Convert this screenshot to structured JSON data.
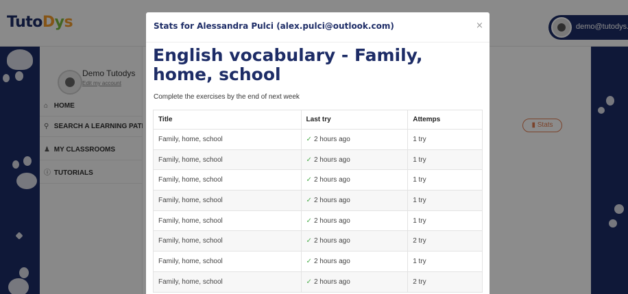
{
  "app": {
    "logo": {
      "part1": "Tuto",
      "part2": "D",
      "part3": "y",
      "part4": "s"
    },
    "user_email": "demo@tutodys.eu",
    "profile": {
      "name": "Demo Tutodys",
      "edit_link": "Edit my account"
    },
    "nav": [
      {
        "label": "HOME",
        "icon": "home-icon"
      },
      {
        "label": "SEARCH A LEARNING PATH",
        "icon": "search-icon"
      },
      {
        "label": "MY CLASSROOMS",
        "icon": "classrooms-icon"
      },
      {
        "label": "TUTORIALS",
        "icon": "tutorials-icon"
      }
    ],
    "stats_button_label": "Stats"
  },
  "modal": {
    "title": "Stats for Alessandra Pulci (alex.pulci@outlook.com)",
    "close_label": "×",
    "lesson_title": "English vocabulary - Family, home, school",
    "lesson_subtitle": "Complete the exercises by the end of next week",
    "table": {
      "headers": [
        "Title",
        "Last try",
        "Attemps"
      ],
      "rows": [
        [
          "Family, home, school",
          "2 hours ago",
          "1 try"
        ],
        [
          "Family, home, school",
          "2 hours ago",
          "1 try"
        ],
        [
          "Family, home, school",
          "2 hours ago",
          "1 try"
        ],
        [
          "Family, home, school",
          "2 hours ago",
          "1 try"
        ],
        [
          "Family, home, school",
          "2 hours ago",
          "1 try"
        ],
        [
          "Family, home, school",
          "2 hours ago",
          "2 try"
        ],
        [
          "Family, home, school",
          "2 hours ago",
          "1 try"
        ],
        [
          "Family, home, school",
          "2 hours ago",
          "2 try"
        ]
      ]
    }
  },
  "colors": {
    "brand_navy": "#1d2c66",
    "accent_orange": "#e07b4f",
    "check_green": "#4cae4c",
    "logo_orange": "#f39c2b",
    "logo_green": "#78b63c"
  }
}
